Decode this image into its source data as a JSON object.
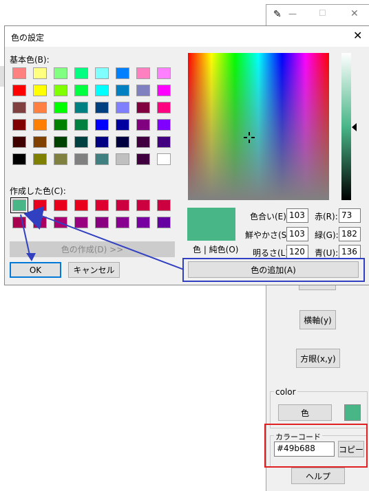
{
  "bg_window": {
    "title_controls": {
      "min": "—",
      "max": "☐",
      "close": "✕"
    },
    "buttons": {
      "y_axis": "横軸(y)",
      "grid": "方眼(x,y)",
      "color": "色",
      "copy": "コピー",
      "help": "ヘルプ"
    },
    "color_group_label": "color",
    "color_code_label": "カラーコード",
    "color_code_value": "#49b688",
    "current_color": "#49b688"
  },
  "dialog": {
    "title": "色の設定",
    "basic_colors_label": "基本色(B):",
    "custom_colors_label": "作成した色(C):",
    "define_button": "色の作成(D) >>",
    "ok_button": "OK",
    "cancel_button": "キャンセル",
    "add_button": "色の追加(A)",
    "color_solid_label": "色 | 純色(O)",
    "fields": {
      "hue_label": "色合い(E):",
      "hue": "103",
      "sat_label": "鮮やかさ(S):",
      "sat": "103",
      "lum_label": "明るさ(L):",
      "lum": "120",
      "red_label": "赤(R):",
      "red": "73",
      "green_label": "緑(G):",
      "green": "182",
      "blue_label": "青(U):",
      "blue": "136"
    },
    "basic_colors": [
      [
        "#ff8080",
        "#ffff80",
        "#80ff80",
        "#00ff80",
        "#80ffff",
        "#0080ff",
        "#ff80c0",
        "#ff80ff"
      ],
      [
        "#ff0000",
        "#ffff00",
        "#80ff00",
        "#00ff40",
        "#00ffff",
        "#0080c0",
        "#8080c0",
        "#ff00ff"
      ],
      [
        "#804040",
        "#ff8040",
        "#00ff00",
        "#008080",
        "#004080",
        "#8080ff",
        "#800040",
        "#ff0080"
      ],
      [
        "#800000",
        "#ff8000",
        "#008000",
        "#008040",
        "#0000ff",
        "#0000a0",
        "#800080",
        "#8000ff"
      ],
      [
        "#400000",
        "#804000",
        "#004000",
        "#004040",
        "#000080",
        "#000040",
        "#400040",
        "#400080"
      ],
      [
        "#000000",
        "#808000",
        "#808040",
        "#808080",
        "#408080",
        "#c0c0c0",
        "#400040",
        "#ffffff"
      ]
    ],
    "custom_colors": [
      [
        "#49b688",
        "#e8001c",
        "#e8001c",
        "#e8001c",
        "#dd0030",
        "#cc0040",
        "#cc0040",
        "#cc0040"
      ],
      [
        "#aa0050",
        "#aa0060",
        "#aa0070",
        "#990080",
        "#880080",
        "#880090",
        "#7700a0",
        "#6600a0"
      ]
    ],
    "preview_color": "#49b688"
  }
}
